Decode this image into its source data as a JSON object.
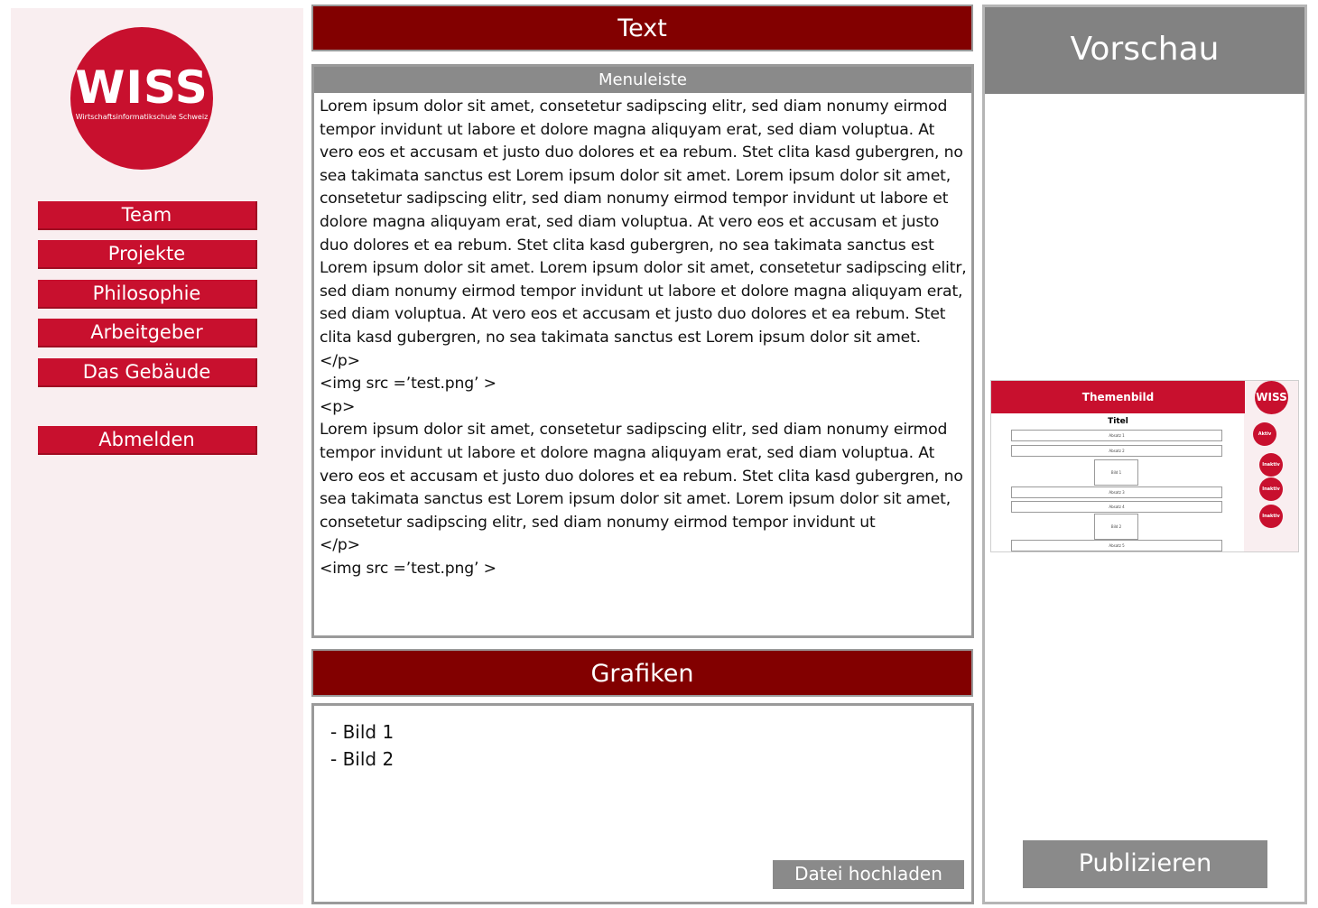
{
  "sidebar": {
    "logo": {
      "name": "WISS",
      "subtitle": "Wirtschaftsinformatikschule Schweiz"
    },
    "nav": [
      {
        "label": "Team"
      },
      {
        "label": "Projekte"
      },
      {
        "label": "Philosophie"
      },
      {
        "label": "Arbeitgeber"
      },
      {
        "label": "Das Gebäude"
      }
    ],
    "logout_label": "Abmelden"
  },
  "text_section": {
    "title": "Text",
    "menubar_label": "Menuleiste",
    "content": "Lorem ipsum dolor sit amet, consetetur sadipscing elitr, sed diam nonumy eirmod tempor invidunt ut labore et dolore magna aliquyam erat, sed diam voluptua. At vero eos et accusam et justo duo dolores et ea rebum. Stet clita kasd gubergren, no sea takimata sanctus est Lorem ipsum dolor sit amet. Lorem ipsum dolor sit amet, consetetur sadipscing elitr, sed diam nonumy eirmod tempor invidunt ut labore et dolore magna aliquyam erat, sed diam voluptua. At vero eos et accusam et justo duo dolores et ea rebum. Stet clita kasd gubergren, no sea takimata sanctus est Lorem ipsum dolor sit amet. Lorem ipsum dolor sit amet, consetetur sadipscing elitr, sed diam nonumy eirmod tempor invidunt ut labore et dolore magna aliquyam erat, sed diam voluptua. At vero eos et accusam et justo duo dolores et ea rebum. Stet clita kasd gubergren, no sea takimata sanctus est Lorem ipsum dolor sit amet.\n</p>\n<img src =’test.png’ >\n<p>\nLorem ipsum dolor sit amet, consetetur sadipscing elitr, sed diam nonumy eirmod tempor invidunt ut labore et dolore magna aliquyam erat, sed diam voluptua. At vero eos et accusam et justo duo dolores et ea rebum. Stet clita kasd gubergren, no sea takimata sanctus est Lorem ipsum dolor sit amet. Lorem ipsum dolor sit amet, consetetur sadipscing elitr, sed diam nonumy eirmod tempor invidunt ut\n</p>\n<img src =’test.png’ >"
  },
  "graphics_section": {
    "title": "Grafiken",
    "items": [
      "- Bild 1",
      "- Bild 2"
    ],
    "upload_label": "Datei hochladen"
  },
  "preview": {
    "title": "Vorschau",
    "publish_label": "Publizieren",
    "thumbnail": {
      "header": "Themenbild",
      "logo": "WISS",
      "title": "Titel",
      "rows": [
        "Absatz 1",
        "Absatz 2",
        "Bild 1",
        "Absatz 3",
        "Absatz 4",
        "Bild 2",
        "Absatz 5"
      ],
      "nav_dots": [
        "Aktiv",
        "Inaktiv",
        "Inaktiv",
        "Inaktiv"
      ]
    }
  },
  "colors": {
    "brand_red": "#c8102e",
    "header_dark_red": "#820000",
    "gray": "#8a8a8a",
    "sidebar_bg": "#f9eef0"
  }
}
